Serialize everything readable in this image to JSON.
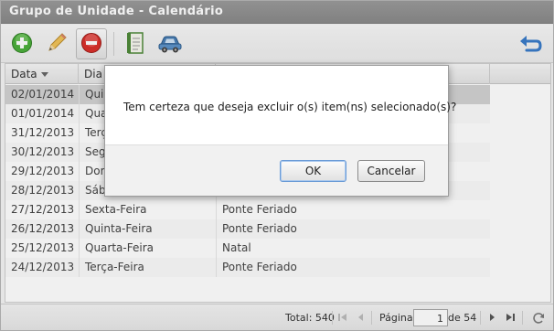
{
  "window": {
    "title": "Grupo de Unidade - Calendário"
  },
  "toolbar": {
    "buttons": [
      {
        "name": "add",
        "icon": "plus-circle-icon",
        "color": "#4caf3c"
      },
      {
        "name": "edit",
        "icon": "pencil-icon",
        "color": "#e8b84a"
      },
      {
        "name": "delete",
        "icon": "minus-circle-icon",
        "color": "#d9302b",
        "active": true
      },
      {
        "name": "notes",
        "icon": "notebook-icon",
        "color": "#4f8a3a"
      },
      {
        "name": "vehicle",
        "icon": "car-icon",
        "color": "#4a7fb5"
      },
      {
        "name": "back",
        "icon": "return-arrow-icon",
        "color": "#3a7cc9"
      }
    ]
  },
  "grid": {
    "columns": [
      {
        "label": "Data",
        "sorted": "desc"
      },
      {
        "label": "Dia"
      },
      {
        "label": ""
      }
    ],
    "rows": [
      {
        "data": "02/01/2014",
        "dia": "Quinta-Feira",
        "desc": "",
        "selected": true
      },
      {
        "data": "01/01/2014",
        "dia": "Quarta-Feira",
        "desc": ""
      },
      {
        "data": "31/12/2013",
        "dia": "Terça-Feira",
        "desc": ""
      },
      {
        "data": "30/12/2013",
        "dia": "Segunda-Feira",
        "desc": ""
      },
      {
        "data": "29/12/2013",
        "dia": "Domingo",
        "desc": ""
      },
      {
        "data": "28/12/2013",
        "dia": "Sábado",
        "desc": ""
      },
      {
        "data": "27/12/2013",
        "dia": "Sexta-Feira",
        "desc": "Ponte Feriado"
      },
      {
        "data": "26/12/2013",
        "dia": "Quinta-Feira",
        "desc": "Ponte Feriado"
      },
      {
        "data": "25/12/2013",
        "dia": "Quarta-Feira",
        "desc": "Natal"
      },
      {
        "data": "24/12/2013",
        "dia": "Terça-Feira",
        "desc": "Ponte Feriado"
      }
    ]
  },
  "pager": {
    "total_label": "Total: 540",
    "page_label": "Página",
    "page_value": "1",
    "of_label": "de 54"
  },
  "dialog": {
    "message": "Tem certeza que deseja excluir o(s) item(ns) selecionado(s)?",
    "ok_label": "OK",
    "cancel_label": "Cancelar"
  }
}
